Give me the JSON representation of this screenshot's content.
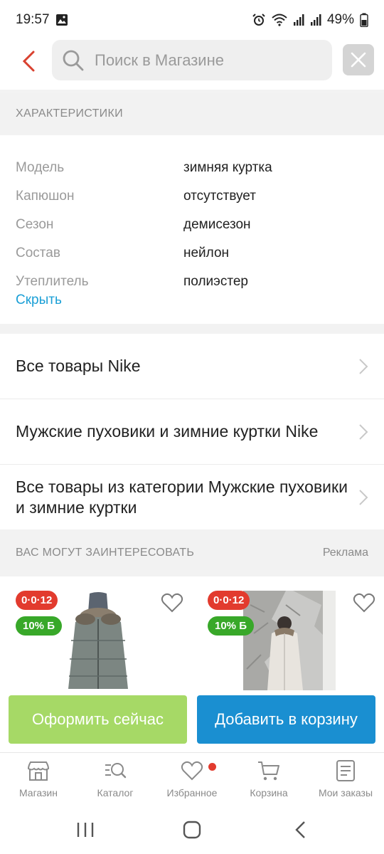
{
  "status_bar": {
    "time": "19:57",
    "battery": "49%",
    "icons": [
      "gallery-icon",
      "alarm-icon",
      "wifi-icon",
      "signal-icon",
      "signal-icon",
      "battery-icon"
    ]
  },
  "header": {
    "search_placeholder": "Поиск в Магазине",
    "icons": [
      "back-arrow-icon",
      "search-icon",
      "close-icon"
    ]
  },
  "specs": {
    "heading": "ХАРАКТЕРИСТИКИ",
    "rows": [
      {
        "label": "Модель",
        "value": "зимняя куртка"
      },
      {
        "label": "Капюшон",
        "value": "отсутствует"
      },
      {
        "label": "Сезон",
        "value": "демисезон"
      },
      {
        "label": "Состав",
        "value": "нейлон"
      },
      {
        "label": "Утеплитель",
        "value": "полиэстер"
      }
    ],
    "hide_link": "Скрыть"
  },
  "links": [
    {
      "label": "Все товары Nike"
    },
    {
      "label": "Мужские пуховики и зимние куртки Nike"
    },
    {
      "label": "Все товары из категории Мужские пуховики и зимние куртки"
    }
  ],
  "recommendations": {
    "title": "ВАС МОГУТ ЗАИНТЕРЕСОВАТЬ",
    "ad_label": "Реклама",
    "products": [
      {
        "timer": "0·0·12",
        "discount": "10% Б"
      },
      {
        "timer": "0·0·12",
        "discount": "10% Б"
      }
    ]
  },
  "actions": {
    "order_label": "Оформить сейчас",
    "cart_label": "Добавить в корзину"
  },
  "bottom_nav": {
    "items": [
      {
        "label": "Магазин",
        "icon": "store-icon"
      },
      {
        "label": "Каталог",
        "icon": "catalog-icon"
      },
      {
        "label": "Избранное",
        "icon": "heart-icon",
        "has_badge": true
      },
      {
        "label": "Корзина",
        "icon": "cart-icon"
      },
      {
        "label": "Мои заказы",
        "icon": "orders-icon"
      }
    ]
  },
  "colors": {
    "accent_red": "#e23b2e",
    "link_blue": "#1a9fd6",
    "order_green": "#a6d966",
    "cart_blue": "#1a8fd1",
    "discount_green": "#38a829"
  }
}
